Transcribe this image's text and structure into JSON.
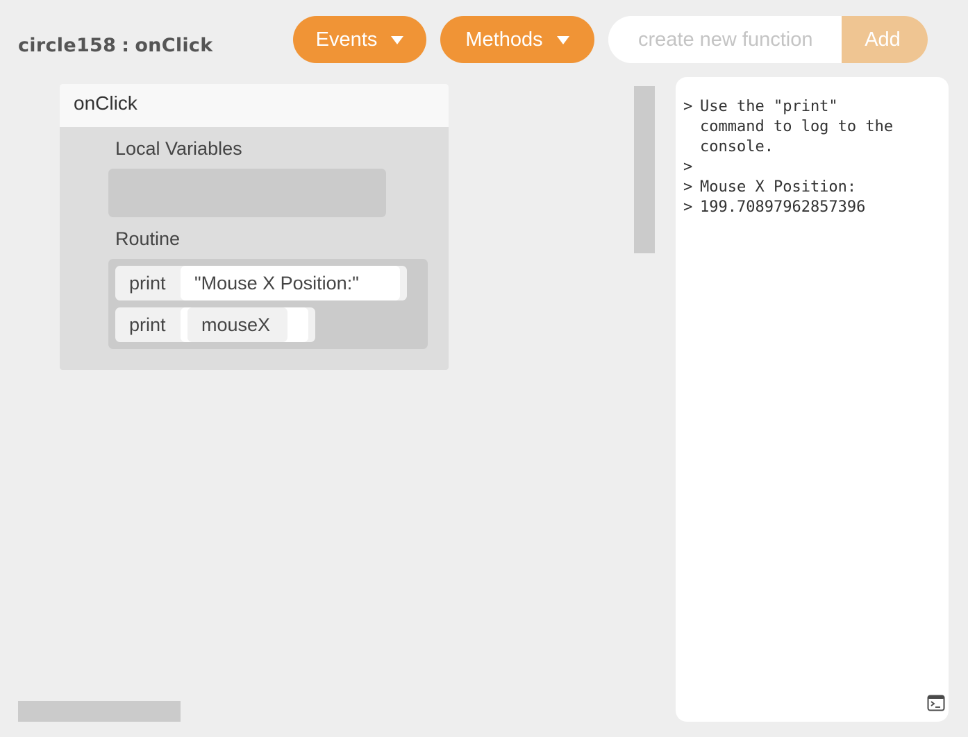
{
  "breadcrumb": {
    "object_name": "circle158",
    "separator": ":",
    "function_name": "onClick"
  },
  "toolbar": {
    "events_label": "Events",
    "methods_label": "Methods",
    "new_function_placeholder": "create new function",
    "add_label": "Add"
  },
  "function_card": {
    "title": "onClick",
    "local_variables_label": "Local Variables",
    "routine_label": "Routine",
    "statements": [
      {
        "keyword": "print",
        "argument": "\"Mouse X Position:\""
      },
      {
        "keyword": "print",
        "argument": "mouseX"
      }
    ]
  },
  "console": {
    "prompt": ">",
    "lines": [
      "Use the \"print\" command to log to the console.",
      "",
      "Mouse X Position:",
      "199.70897962857396"
    ],
    "toggle_icon": "terminal-icon"
  },
  "colors": {
    "accent": "#f09436",
    "add_button": "#efc592",
    "background": "#eeeeee"
  }
}
